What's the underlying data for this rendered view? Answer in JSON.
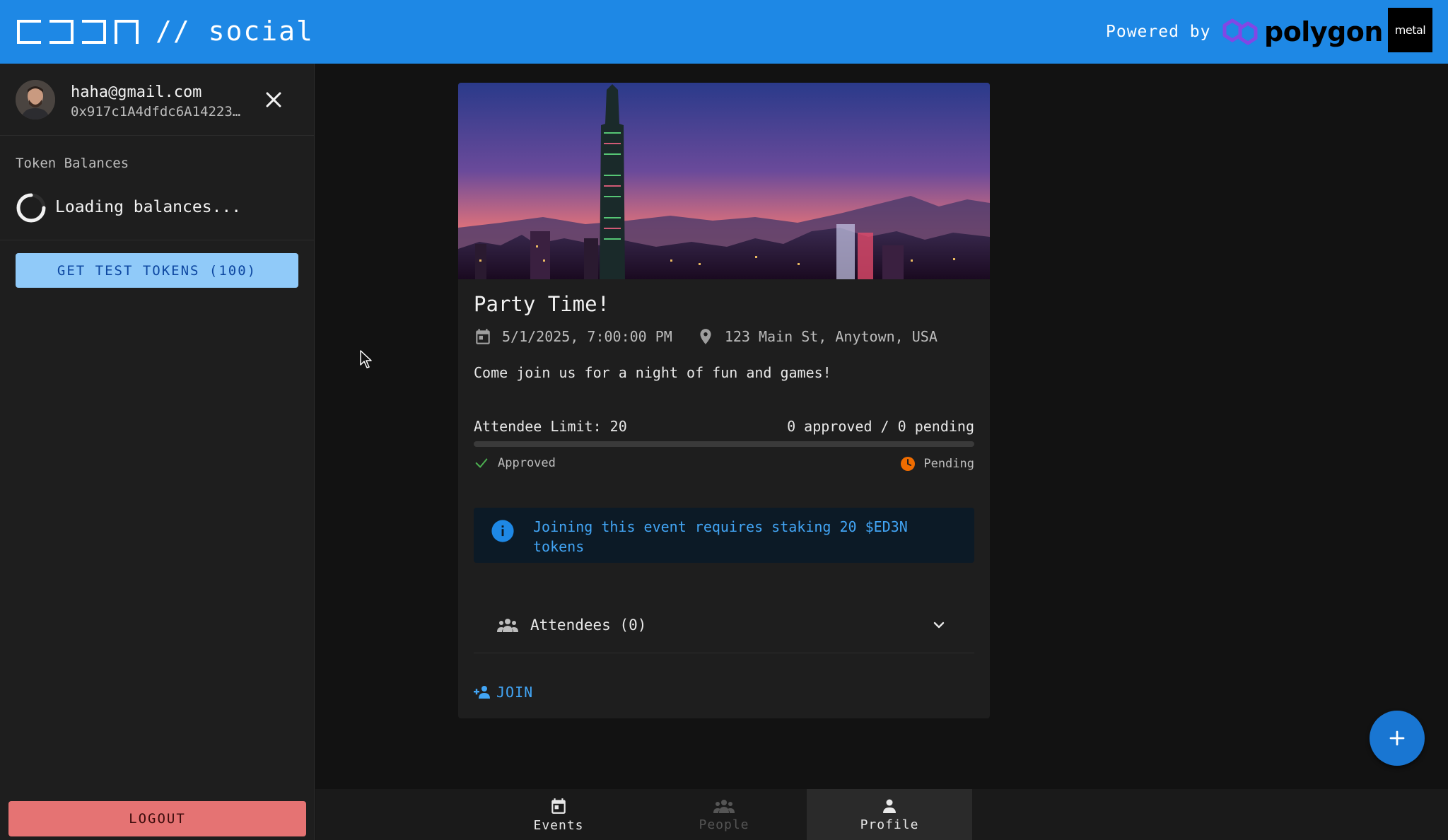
{
  "header": {
    "logo_text": "// social",
    "powered_label": "Powered by",
    "polygon_word": "polygon",
    "metal_word": "metal"
  },
  "sidebar": {
    "user_email": "haha@gmail.com",
    "user_address": "0x917c1A4dfdc6A14223…",
    "token_balances_title": "Token Balances",
    "loading_text": "Loading balances...",
    "test_tokens_label": "GET TEST TOKENS (100)",
    "logout_label": "LOGOUT"
  },
  "event": {
    "title": "Party Time!",
    "datetime": "5/1/2025, 7:00:00 PM",
    "location": "123 Main St, Anytown, USA",
    "description": "Come join us for a night of fun and games!",
    "attendee_limit": "Attendee Limit: 20",
    "counts": "0 approved / 0 pending",
    "approved_fraction": 0,
    "approved_label": "Approved",
    "pending_label": "Pending",
    "stake_notice": "Joining this event requires staking 20 $ED3N tokens",
    "attendees_label": "Attendees (0)",
    "join_label": "JOIN"
  },
  "bottom_nav": {
    "events": "Events",
    "people": "People",
    "profile": "Profile"
  },
  "colors": {
    "header_bg": "#1e88e5",
    "accent": "#42a5f5",
    "logout": "#e57373",
    "test_button": "#90caf9",
    "pending": "#ef6c00",
    "approved": "#4caf50"
  }
}
